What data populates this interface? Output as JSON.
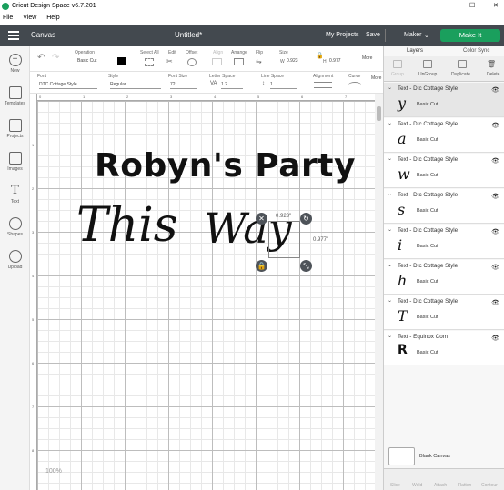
{
  "titlebar": {
    "app_title": "Cricut Design Space  v6.7.201",
    "minimize": "–",
    "maximize": "☐",
    "close": "✕"
  },
  "menubar": {
    "items": [
      "File",
      "View",
      "Help"
    ]
  },
  "header": {
    "menu_icon": "hamburger-icon",
    "canvas_label": "Canvas",
    "doc_title": "Untitled*",
    "my_projects": "My Projects",
    "save": "Save",
    "machine": "Maker",
    "make_it": "Make It"
  },
  "toolbar1": {
    "operation_label": "Operation",
    "operation_value": "Basic Cut",
    "select_all": "Select All",
    "edit": "Edit",
    "offset": "Offset",
    "align": "Align",
    "arrange": "Arrange",
    "flip": "Flip",
    "size": "Size",
    "w_label": "W",
    "w_value": "0.923",
    "h_label": "H",
    "h_value": "0.977",
    "more": "More"
  },
  "toolbar2": {
    "font_label": "Font",
    "font_value": "DTC Cottage Style",
    "style_label": "Style",
    "style_value": "Regular",
    "font_size_label": "Font Size",
    "font_size_value": "72",
    "letter_space_label": "Letter Space",
    "letter_space_value": "1.2",
    "line_space_label": "Line Space",
    "line_space_value": "1",
    "alignment_label": "Alignment",
    "curve_label": "Curve",
    "more": "More"
  },
  "sidebar": {
    "items": [
      {
        "label": "New",
        "icon": "plus-icon"
      },
      {
        "label": "Templates",
        "icon": "shirt-icon"
      },
      {
        "label": "Projects",
        "icon": "folder-icon"
      },
      {
        "label": "Images",
        "icon": "image-icon"
      },
      {
        "label": "Text",
        "icon": "text-icon"
      },
      {
        "label": "Shapes",
        "icon": "shapes-icon"
      },
      {
        "label": "Upload",
        "icon": "upload-icon"
      }
    ]
  },
  "canvas": {
    "line1": "Robyn's Party",
    "line2a": "This",
    "line2b": "Way",
    "width_readout": "0.923\"",
    "height_readout": "0.977\"",
    "zoom": "100%",
    "ruler_top": [
      "0",
      "1",
      "2",
      "3",
      "4",
      "5",
      "6",
      "7"
    ],
    "ruler_left": [
      "1",
      "2",
      "3",
      "4",
      "5",
      "6",
      "7",
      "8"
    ]
  },
  "layers_panel": {
    "tab_layers": "Layers",
    "tab_color_sync": "Color Sync",
    "actions": [
      "Group",
      "UnGroup",
      "Duplicate",
      "Delete"
    ],
    "layers": [
      {
        "title": "Text - Dtc Cottage Style",
        "glyph": "y",
        "cut": "Basic Cut",
        "selected": true
      },
      {
        "title": "Text - Dtc Cottage Style",
        "glyph": "a",
        "cut": "Basic Cut"
      },
      {
        "title": "Text - Dtc Cottage Style",
        "glyph": "w",
        "cut": "Basic Cut"
      },
      {
        "title": "Text - Dtc Cottage Style",
        "glyph": "s",
        "cut": "Basic Cut"
      },
      {
        "title": "Text - Dtc Cottage Style",
        "glyph": "i",
        "cut": "Basic Cut"
      },
      {
        "title": "Text - Dtc Cottage Style",
        "glyph": "h",
        "cut": "Basic Cut"
      },
      {
        "title": "Text - Dtc Cottage Style",
        "glyph": "T",
        "cut": "Basic Cut"
      },
      {
        "title": "Text - Equinox Com",
        "glyph": "R",
        "cut": "Basic Cut"
      }
    ],
    "blank_canvas": "Blank Canvas",
    "bottom_actions": [
      "Slice",
      "Weld",
      "Attach",
      "Flatten",
      "Contour"
    ]
  },
  "colors": {
    "header_bg": "#43494f",
    "make_it": "#1a9f5d"
  }
}
